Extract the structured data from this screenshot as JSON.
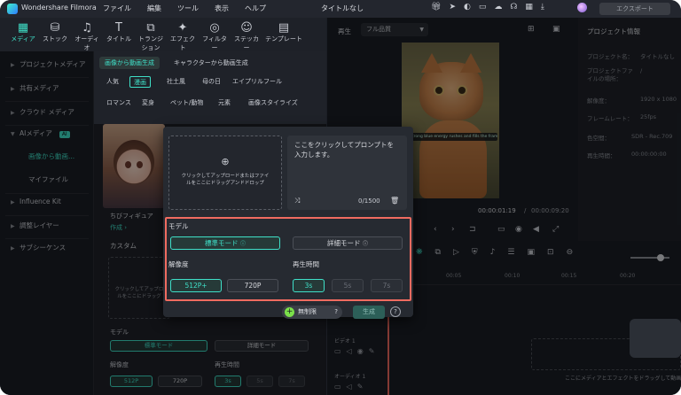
{
  "titlebar": {
    "app_name": "Wondershare Filmora",
    "menu": [
      "ファイル",
      "編集",
      "ツール",
      "表示",
      "ヘルプ"
    ],
    "doc_title": "タイトルなし",
    "export_label": "エクスポート"
  },
  "tooltabs": [
    {
      "label": "メディア",
      "icon": "▦"
    },
    {
      "label": "ストック",
      "icon": "⛁"
    },
    {
      "label": "オーディオ",
      "icon": "♫"
    },
    {
      "label": "タイトル",
      "icon": "T"
    },
    {
      "label": "トランジション",
      "icon": "⧉"
    },
    {
      "label": "エフェクト",
      "icon": "✦"
    },
    {
      "label": "フィルター",
      "icon": "◎"
    },
    {
      "label": "ステッカー",
      "icon": "☺"
    },
    {
      "label": "テンプレート",
      "icon": "▤"
    }
  ],
  "sidebar": {
    "items": [
      {
        "label": "プロジェクトメディア"
      },
      {
        "label": "共有メディア"
      },
      {
        "label": "クラウド メディア"
      },
      {
        "label": "AIメディア",
        "badge": "AI"
      },
      {
        "label": "画像から動画..."
      },
      {
        "label": "マイファイル"
      },
      {
        "label": "Influence Kit"
      },
      {
        "label": "調整レイヤー"
      },
      {
        "label": "サブシーケンス"
      }
    ]
  },
  "content": {
    "tabs": [
      "画像から動画生成",
      "キャラクターから動画生成"
    ],
    "categories_row1": [
      "人気",
      "漫画",
      "社土風",
      "母の日",
      "エイプリルフール"
    ],
    "categories_row2": [
      "ロマンス",
      "変身",
      "ペット/動物",
      "元素",
      "画像スタイライズ"
    ],
    "card_title": "ちびフィギュア",
    "card_action": "作成 ›",
    "custom_label": "カスタム",
    "bg_drop_text": "クリックしてアップロ\nルをここにドラッグ",
    "bg_model": "モデル",
    "bg_standard": "標準モード",
    "bg_detail": "詳細モード",
    "bg_resolution": "解像度",
    "bg_duration": "再生時間",
    "bg_512": "512P",
    "bg_720": "720P",
    "bg_3s": "3s",
    "bg_5s": "5s",
    "bg_7s": "7s"
  },
  "preview": {
    "label": "再生",
    "quality": "フル品質",
    "caption": "A strong blue energy rushes and fills the frame",
    "time_current": "00:00:01:19",
    "time_total": "00:00:09:20"
  },
  "properties": {
    "title": "プロジェクト情報",
    "rows": [
      {
        "key": "プロジェクト名：",
        "value": "タイトルなし"
      },
      {
        "key": "プロジェクトファイルの場所：",
        "value": "/"
      },
      {
        "key": "解像度：",
        "value": "1920 x 1080"
      },
      {
        "key": "フレームレート：",
        "value": "25fps"
      },
      {
        "key": "色空間：",
        "value": "SDR - Rec.709"
      },
      {
        "key": "再生時間：",
        "value": "00:00:00:00"
      }
    ]
  },
  "timeline": {
    "ruler": [
      "00:05",
      "00:10",
      "00:15",
      "00:20",
      "00:25",
      "00:30"
    ],
    "video_track": "ビデオ 1",
    "audio_track": "オーディオ 1",
    "drop_hint": "ここにメディアとエフェクトをドラッグして動画を"
  },
  "modal": {
    "upload_text": "クリックしてアップロードまたはファイルをここにドラッグアンドドロップ",
    "prompt_placeholder": "ここをクリックしてプロンプトを入力します。",
    "char_count": "0/1500",
    "model_label": "モデル",
    "standard_mode": "標準モード",
    "detail_mode": "詳細モード",
    "resolution_label": "解像度",
    "res_512": "512P+",
    "res_720": "720P",
    "duration_label": "再生時間",
    "dur_3s": "3s",
    "dur_5s": "5s",
    "dur_7s": "7s",
    "unlimited_label": "無制限",
    "generate_label": "生成"
  },
  "colors": {
    "accent": "#3fe0c8",
    "highlight_box": "#f06b60",
    "background": "#1b1e25"
  }
}
